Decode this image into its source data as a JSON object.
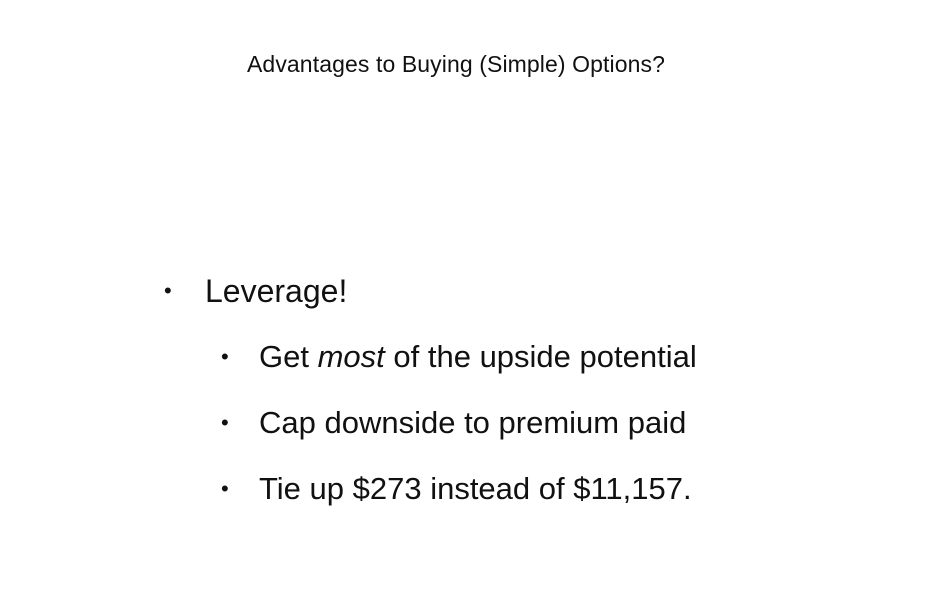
{
  "slide": {
    "title": "Advantages to Buying (Simple) Options?",
    "bullet_glyph": "•",
    "main_bullet": "Leverage!",
    "sub_bullets": [
      {
        "before": "Get ",
        "emphasis": "most",
        "after": " of the upside potential"
      },
      {
        "text": "Cap downside to premium paid"
      },
      {
        "text": "Tie up $273 instead of $11,157."
      }
    ]
  }
}
